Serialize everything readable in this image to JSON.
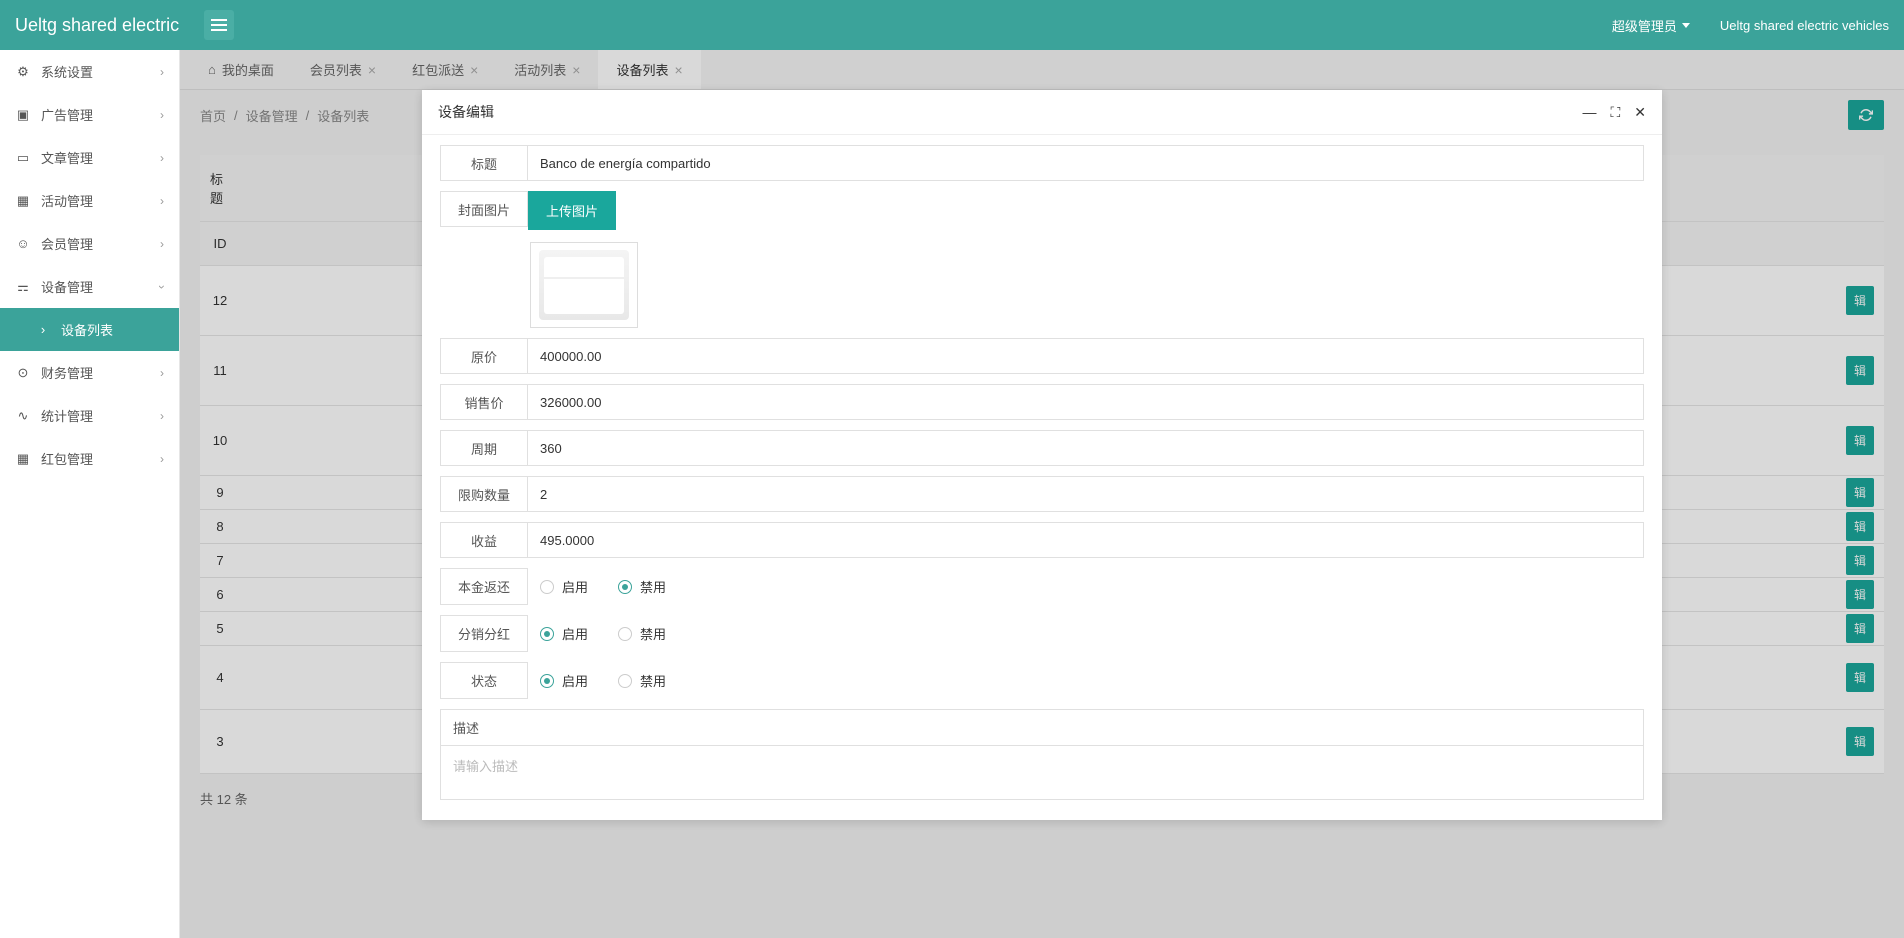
{
  "header": {
    "title": "Ueltg shared electric",
    "user": "超级管理员",
    "app_name": "Ueltg shared electric vehicles"
  },
  "sidebar": {
    "items": [
      {
        "icon": "gear",
        "label": "系统设置"
      },
      {
        "icon": "image",
        "label": "广告管理"
      },
      {
        "icon": "book",
        "label": "文章管理"
      },
      {
        "icon": "calendar",
        "label": "活动管理"
      },
      {
        "icon": "user",
        "label": "会员管理"
      },
      {
        "icon": "sliders",
        "label": "设备管理",
        "expanded": true
      },
      {
        "icon": "chevron",
        "label": "设备列表",
        "active": true
      },
      {
        "icon": "money",
        "label": "财务管理"
      },
      {
        "icon": "chart",
        "label": "统计管理"
      },
      {
        "icon": "gift",
        "label": "红包管理"
      }
    ]
  },
  "tabs": [
    {
      "label": "我的桌面",
      "icon": "home",
      "closable": false
    },
    {
      "label": "会员列表",
      "closable": true
    },
    {
      "label": "红包派送",
      "closable": true
    },
    {
      "label": "活动列表",
      "closable": true
    },
    {
      "label": "设备列表",
      "closable": true,
      "active": true
    }
  ],
  "breadcrumb": [
    "首页",
    "设备管理",
    "设备列表"
  ],
  "table": {
    "header_title": "标题",
    "header_id": "ID",
    "rows": [
      12,
      11,
      10,
      9,
      8,
      7,
      6,
      5,
      4,
      3
    ],
    "action_label": "辑",
    "total_text": "共 12 条"
  },
  "modal": {
    "title": "设备编辑",
    "form": {
      "title_label": "标题",
      "title_value": "Banco de energía compartido",
      "cover_label": "封面图片",
      "upload_btn": "上传图片",
      "orig_price_label": "原价",
      "orig_price_value": "400000.00",
      "sale_price_label": "销售价",
      "sale_price_value": "326000.00",
      "period_label": "周期",
      "period_value": "360",
      "limit_label": "限购数量",
      "limit_value": "2",
      "profit_label": "收益",
      "profit_value": "495.0000",
      "principal_label": "本金返还",
      "dividend_label": "分销分红",
      "status_label": "状态",
      "enable": "启用",
      "disable": "禁用",
      "desc_label": "描述",
      "desc_placeholder": "请输入描述"
    }
  }
}
